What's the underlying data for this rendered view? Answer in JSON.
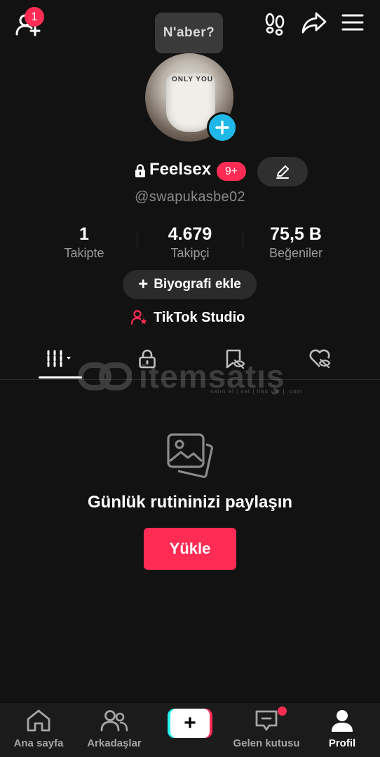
{
  "header": {
    "add_friends_badge": "1",
    "tooltip": "N'aber?"
  },
  "profile": {
    "avatar_mask_text": "ONLY YOU",
    "display_name": "Feelsex",
    "notification_badge": "9+",
    "username": "@swapukasbe02"
  },
  "stats": [
    {
      "value": "1",
      "label": "Takipte"
    },
    {
      "value": "4.679",
      "label": "Takipçi"
    },
    {
      "value": "75,5 B",
      "label": "Beğeniler"
    }
  ],
  "bio_button": {
    "icon": "+",
    "label": "Biyografi ekle"
  },
  "studio_link": {
    "label": "TikTok Studio"
  },
  "tabs": [
    {
      "name": "videos-grid-icon",
      "active": true
    },
    {
      "name": "private-lock-icon",
      "active": false
    },
    {
      "name": "favorites-hidden-icon",
      "active": false
    },
    {
      "name": "liked-hidden-icon",
      "active": false
    }
  ],
  "watermark": {
    "text": "itemsatış",
    "sub": "satın al | sat | ilan ver | .com"
  },
  "empty_state": {
    "title": "Günlük rutininizi paylaşın",
    "button": "Yükle"
  },
  "bottom_nav": {
    "home": "Ana sayfa",
    "friends": "Arkadaşlar",
    "create": "+",
    "inbox": "Gelen kutusu",
    "profile": "Profil"
  },
  "colors": {
    "background": "#121212",
    "accent": "#fe2c55",
    "cyan": "#25f4ee",
    "avatar_add": "#20b8e8"
  }
}
